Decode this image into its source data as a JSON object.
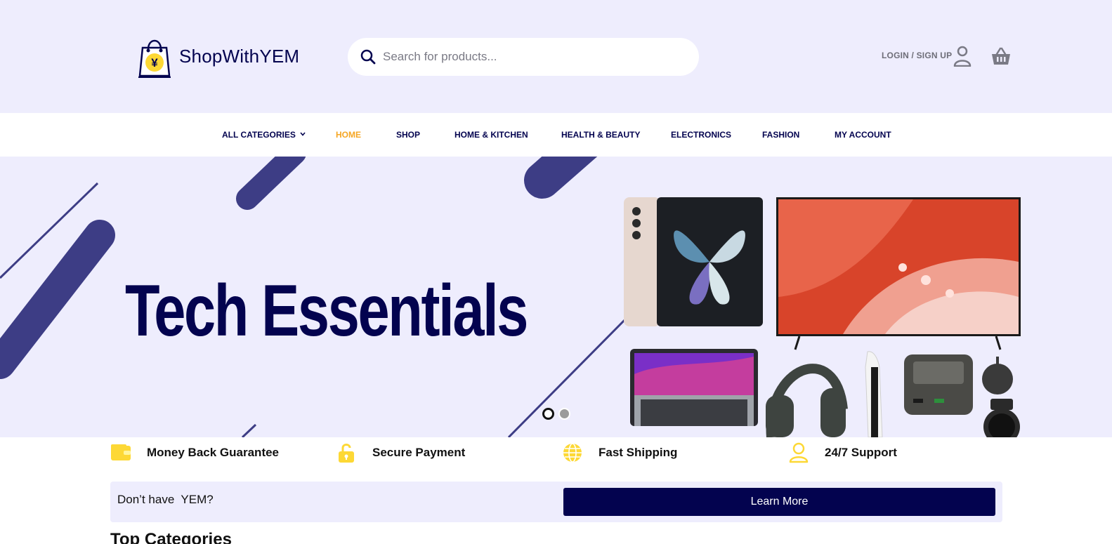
{
  "brand": {
    "name": "ShopWithYEM",
    "logo_symbol": "¥"
  },
  "search": {
    "placeholder": "Search for products..."
  },
  "header": {
    "login_label": "LOGIN / SIGN UP"
  },
  "nav": {
    "items": [
      {
        "label": "ALL CATEGORIES",
        "active": false,
        "dropdown": true
      },
      {
        "label": "HOME",
        "active": true
      },
      {
        "label": "SHOP",
        "active": false
      },
      {
        "label": "HOME & KITCHEN",
        "active": false
      },
      {
        "label": "HEALTH & BEAUTY",
        "active": false
      },
      {
        "label": "ELECTRONICS",
        "active": false
      },
      {
        "label": "FASHION",
        "active": false
      },
      {
        "label": "MY ACCOUNT",
        "active": false
      }
    ]
  },
  "hero": {
    "title": "Tech Essentials",
    "slide_count": 2,
    "active_slide": 1
  },
  "features": [
    {
      "label": "Money Back Guarantee",
      "icon": "wallet-icon"
    },
    {
      "label": "Secure Payment",
      "icon": "unlock-icon"
    },
    {
      "label": "Fast Shipping",
      "icon": "globe-icon"
    },
    {
      "label": "24/7 Support",
      "icon": "user-support-icon"
    }
  ],
  "cta": {
    "text": "Don’t have  YEM?",
    "button_label": "Learn More"
  },
  "section": {
    "title": "Top Categories"
  },
  "colors": {
    "brand_navy": "#03034f",
    "accent_orange": "#f5a623",
    "icon_yellow": "#fdd835",
    "header_bg": "#eeedfd",
    "stripe": "#3d3d85"
  }
}
